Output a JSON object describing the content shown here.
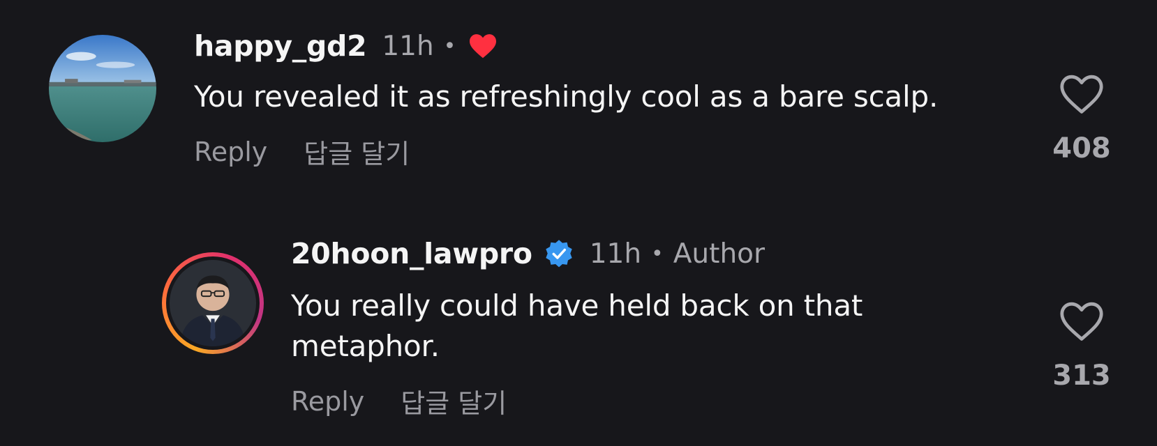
{
  "comments": [
    {
      "username": "happy_gd2",
      "time": "11h",
      "separator": "•",
      "text": "You revealed it as refreshingly cool as a bare scalp.",
      "reply_label": "Reply",
      "reply_label_ko": "답글 달기",
      "like_count": "408",
      "liked_by_author": true,
      "liked_heart_color": "#ff3040"
    },
    {
      "username": "20hoon_lawpro",
      "verified": true,
      "verified_color": "#3897f0",
      "time": "11h",
      "separator": "•",
      "author_badge": "Author",
      "text": "You really could have held back on that metaphor.",
      "reply_label": "Reply",
      "reply_label_ko": "답글 달기",
      "like_count": "313",
      "has_story_ring": true
    }
  ],
  "colors": {
    "background": "#17171b",
    "primary_text": "#f5f5f5",
    "secondary_text": "#a8a8ad"
  }
}
